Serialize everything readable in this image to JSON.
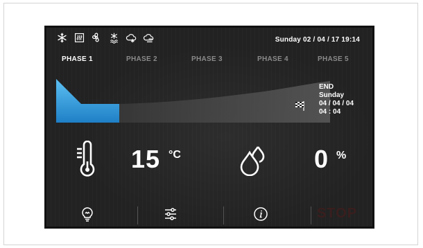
{
  "status_icons": [
    "snowflake-icon",
    "heater-icon",
    "fan-icon",
    "defrost-icon",
    "cloud-snow-icon",
    "cloud-sun-icon"
  ],
  "datetime": "Sunday 02 / 04 / 17  19:14",
  "phases": [
    {
      "label": "PHASE 1",
      "active": true
    },
    {
      "label": "PHASE 2",
      "active": false
    },
    {
      "label": "PHASE 3",
      "active": false
    },
    {
      "label": "PHASE 4",
      "active": false
    },
    {
      "label": "PHASE 5",
      "active": false
    }
  ],
  "end": {
    "title": "END",
    "day": "Sunday",
    "date": "04 / 04 / 04",
    "time": "04 : 04"
  },
  "temperature": {
    "value": "15",
    "unit": "°C"
  },
  "humidity": {
    "value": "0",
    "unit": "%"
  },
  "bottom": {
    "light": "lightbulb-icon",
    "settings": "sliders-icon",
    "info": "info-icon",
    "stop_label": "STOP"
  },
  "colors": {
    "accent_blue": "#2e9be0",
    "stop": "#3a1e1e",
    "screen_bg": "#222222"
  }
}
